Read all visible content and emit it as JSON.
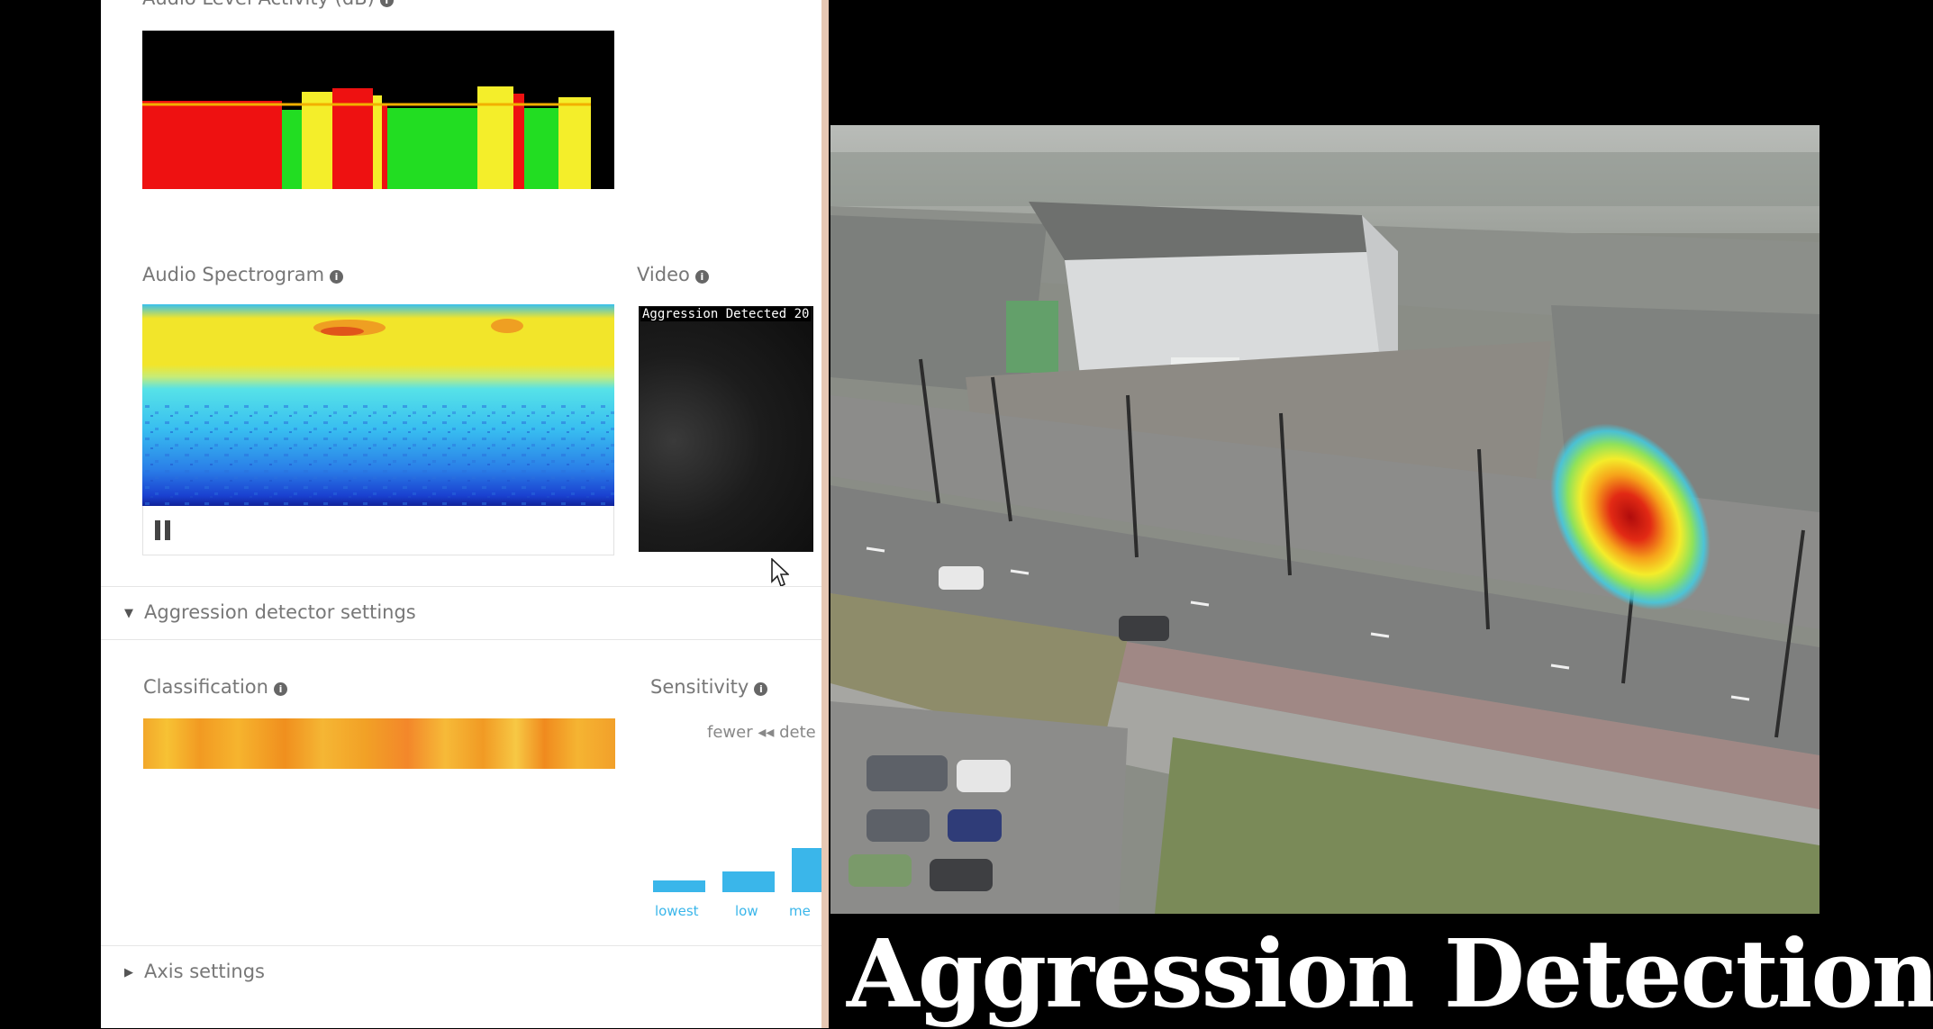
{
  "audio_level": {
    "label": "Audio Level Activity (dB)"
  },
  "spectrogram": {
    "label": "Audio Spectrogram",
    "pause_icon": "pause-icon"
  },
  "video": {
    "label": "Video",
    "overlay_text": "Aggression Detected 20"
  },
  "aggression_settings": {
    "label": "Aggression detector settings",
    "expanded": true
  },
  "classification": {
    "label": "Classification"
  },
  "sensitivity": {
    "label": "Sensitivity",
    "caption": "fewer ◂◂ dete",
    "levels": [
      "lowest",
      "low",
      "me"
    ]
  },
  "axis_settings": {
    "label": "Axis settings",
    "expanded": false
  },
  "overlay_title": "Aggression Detection",
  "colors": {
    "detect_hot": "#c01818",
    "spectro_yellow": "#f2e52a",
    "spectro_blue": "#35b8ea",
    "accent": "#3ab6ea"
  }
}
